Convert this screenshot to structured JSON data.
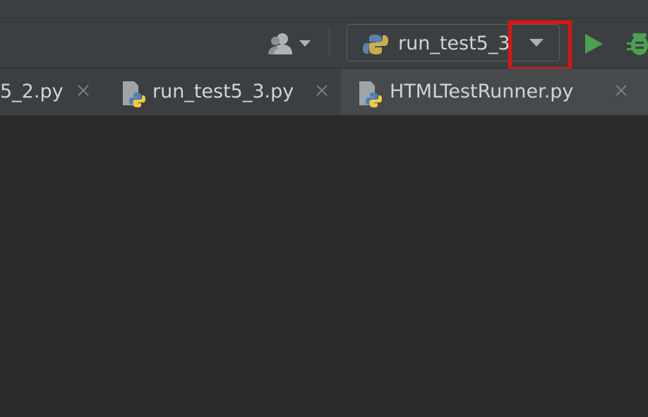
{
  "toolbar": {
    "vcs_user_icon": "person-icon",
    "run_config": {
      "label": "run_test5_3",
      "icon": "python-icon",
      "dropdown_icon": "chevron-down-icon"
    },
    "run_icon": "run-icon",
    "debug_icon": "debug-icon",
    "colors": {
      "run": "#4aa14e",
      "debug": "#4aa14e",
      "highlight": "#e01212"
    }
  },
  "tabs": [
    {
      "label": "5_2.py",
      "icon": "python-file-icon",
      "close_icon": "close-icon",
      "active": false
    },
    {
      "label": "run_test5_3.py",
      "icon": "python-file-icon",
      "close_icon": "close-icon",
      "active": false
    },
    {
      "label": "HTMLTestRunner.py",
      "icon": "python-file-icon",
      "close_icon": "close-icon",
      "active": true
    }
  ]
}
